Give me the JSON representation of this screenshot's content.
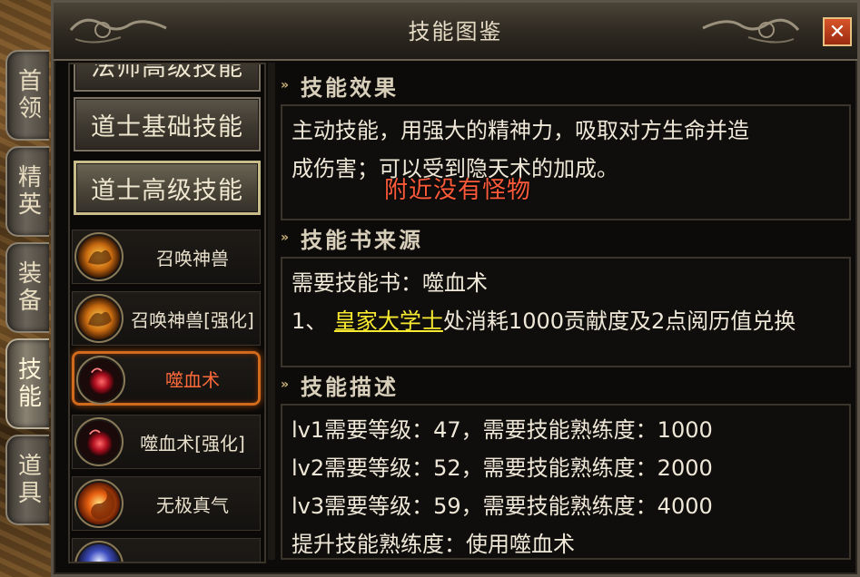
{
  "window": {
    "title": "技能图鉴",
    "close_label": "✕"
  },
  "side_tabs": [
    {
      "label": "首领"
    },
    {
      "label": "精英"
    },
    {
      "label": "装备"
    },
    {
      "label": "技能"
    },
    {
      "label": "道具"
    }
  ],
  "categories": {
    "partial": "法师高级技能",
    "taoist_basic": "道士基础技能",
    "taoist_advanced": "道士高级技能"
  },
  "skills": [
    {
      "name": "召唤神兽",
      "icon": "summon-beast-icon"
    },
    {
      "name": "召唤神兽[强化]",
      "icon": "summon-beast-icon"
    },
    {
      "name": "噬血术",
      "icon": "blood-drain-icon"
    },
    {
      "name": "噬血术[强化]",
      "icon": "blood-drain-icon"
    },
    {
      "name": "无极真气",
      "icon": "infinite-qi-icon"
    },
    {
      "name": "",
      "icon": "crystal-icon"
    }
  ],
  "sections": {
    "effect": {
      "heading": "技能效果",
      "line1": "主动技能，用强大的精神力，吸取对方生命并造",
      "line2": "成伤害；可以受到隐天术的加成。"
    },
    "source": {
      "heading": "技能书来源",
      "line1": "需要技能书：噬血术",
      "prefix": "1、",
      "link": "皇家大学士",
      "suffix": "处消耗1000贡献度及2点阅历值兑换"
    },
    "desc": {
      "heading": "技能描述",
      "lines": [
        "lv1需要等级：47，需要技能熟练度：1000",
        "lv2需要等级：52，需要技能熟练度：2000",
        "lv3需要等级：59，需要技能熟练度：4000",
        "提升技能熟练度：使用噬血术"
      ]
    }
  },
  "overlay_message": "附近没有怪物",
  "colors": {
    "accent_link": "#f8ea30",
    "warning": "#ff5a3a",
    "selected_border": "#d06a1c"
  }
}
